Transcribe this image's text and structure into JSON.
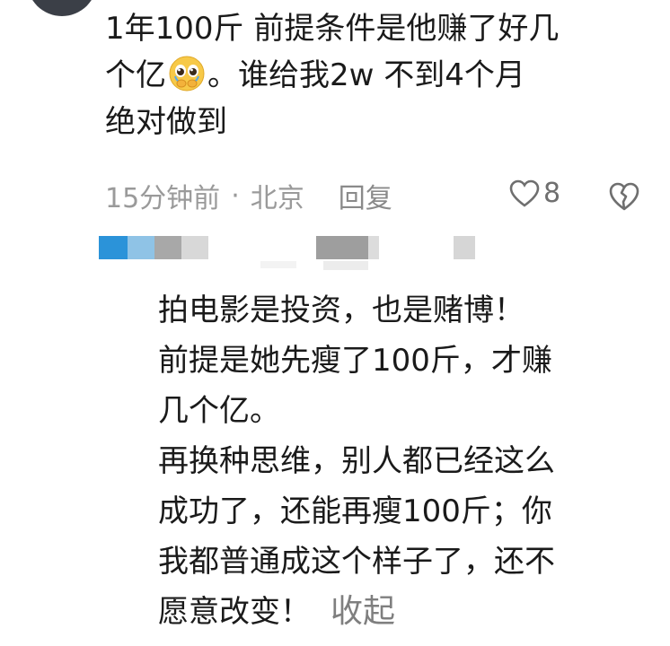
{
  "comment": {
    "text_before_emoji": "1年100斤 前提条件是他赚了好几\n个亿",
    "emoji": "pleading-face-icon",
    "text_after_emoji": "。谁给我2w 不到4个月\n绝对做到",
    "time": "15分钟前",
    "dot": "·",
    "location": "北京",
    "reply_label": "回复",
    "like_count": "8"
  },
  "reply": {
    "text": "拍电影是投资，也是赌博！\n前提是她先瘦了100斤，才赚\n几个亿。\n再换种思维，别人都已经这么\n成功了，还能再瘦100斤；你\n我都普通成这个样子了，还不\n愿意改变！",
    "collapse_label": "收起"
  },
  "colors": {
    "text": "#1a1a1a",
    "meta": "#9a9a9a",
    "link": "#7f7f7f"
  }
}
